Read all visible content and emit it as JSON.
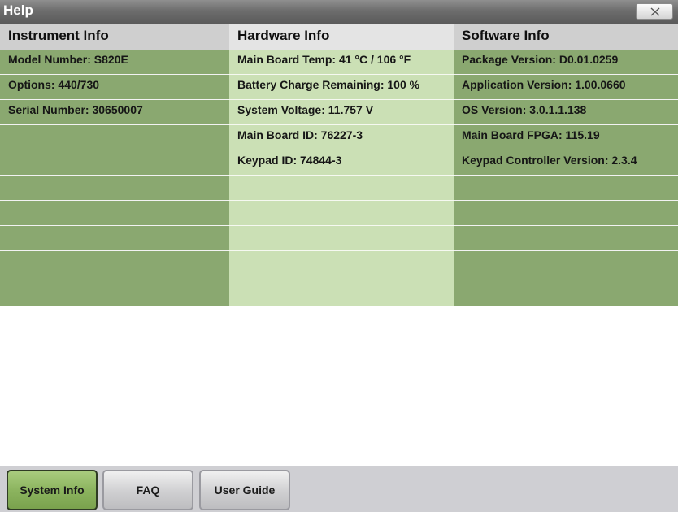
{
  "window": {
    "title": "Help"
  },
  "columns": [
    {
      "header": "Instrument Info",
      "rows": [
        "Model Number: S820E",
        "Options: 440/730",
        "Serial Number: 30650007",
        "",
        "",
        "",
        "",
        "",
        "",
        ""
      ]
    },
    {
      "header": "Hardware Info",
      "rows": [
        "Main Board Temp: 41 °C / 106 °F",
        "Battery Charge Remaining: 100 %",
        "System Voltage: 11.757 V",
        "Main Board ID: 76227-3",
        "Keypad ID: 74844-3",
        "",
        "",
        "",
        "",
        ""
      ]
    },
    {
      "header": "Software Info",
      "rows": [
        "Package Version: D0.01.0259",
        "Application Version: 1.00.0660",
        "OS Version: 3.0.1.1.138",
        "Main Board FPGA: 115.19",
        "Keypad Controller Version: 2.3.4",
        "",
        "",
        "",
        "",
        ""
      ]
    }
  ],
  "tabs": [
    {
      "label": "System Info",
      "active": true
    },
    {
      "label": "FAQ",
      "active": false
    },
    {
      "label": "User Guide",
      "active": false
    }
  ],
  "colors": {
    "active_tab": "#8cb45f",
    "column_dark": "#8aa870",
    "column_light": "#cbe0b5"
  },
  "icons": {
    "close": "close-icon"
  }
}
